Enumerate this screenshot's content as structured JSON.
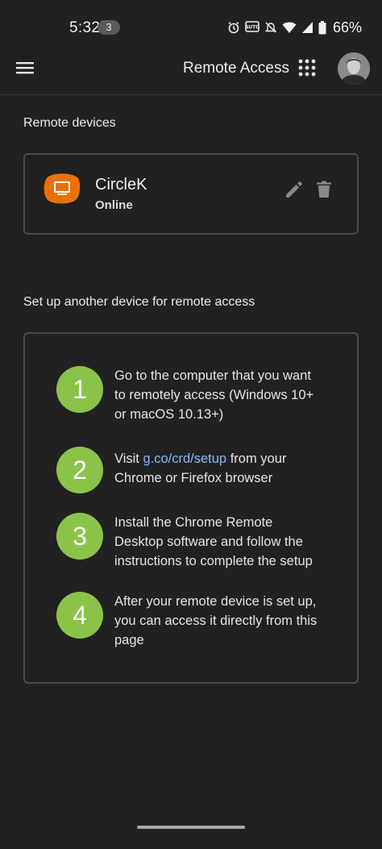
{
  "status_bar": {
    "time": "5:32",
    "notification_count": "3",
    "icons": [
      "alarm-icon",
      "auto-brightness-icon",
      "mute-icon",
      "wifi-icon",
      "signal-icon",
      "battery-icon"
    ],
    "battery_percent": "66%"
  },
  "app_bar": {
    "title": "Remote Access",
    "menu_icon": "hamburger-menu-icon",
    "apps_icon": "apps-grid-icon"
  },
  "remote_devices": {
    "heading": "Remote devices",
    "devices": [
      {
        "name": "CircleK",
        "status": "Online",
        "icon": "computer-icon",
        "icon_color": "#e8710a"
      }
    ]
  },
  "setup": {
    "heading": "Set up another device for remote access",
    "accent_color": "#8bc34a",
    "link_color": "#8ab4f8",
    "steps": [
      {
        "number": "1",
        "line1": "Go to the computer that you want",
        "line2": "to remotely access (Windows 10+",
        "line3": "or macOS 10.13+)"
      },
      {
        "number": "2",
        "prefix": "Visit ",
        "link": "g.co/crd/setup",
        "suffix": " from your",
        "line2": "Chrome or Firefox browser"
      },
      {
        "number": "3",
        "line1": "Install the Chrome Remote",
        "line2": "Desktop software and follow the",
        "line3": "instructions to complete the setup"
      },
      {
        "number": "4",
        "line1": "After your remote device is set up,",
        "line2": "you can access it directly from this",
        "line3": "page"
      }
    ]
  }
}
